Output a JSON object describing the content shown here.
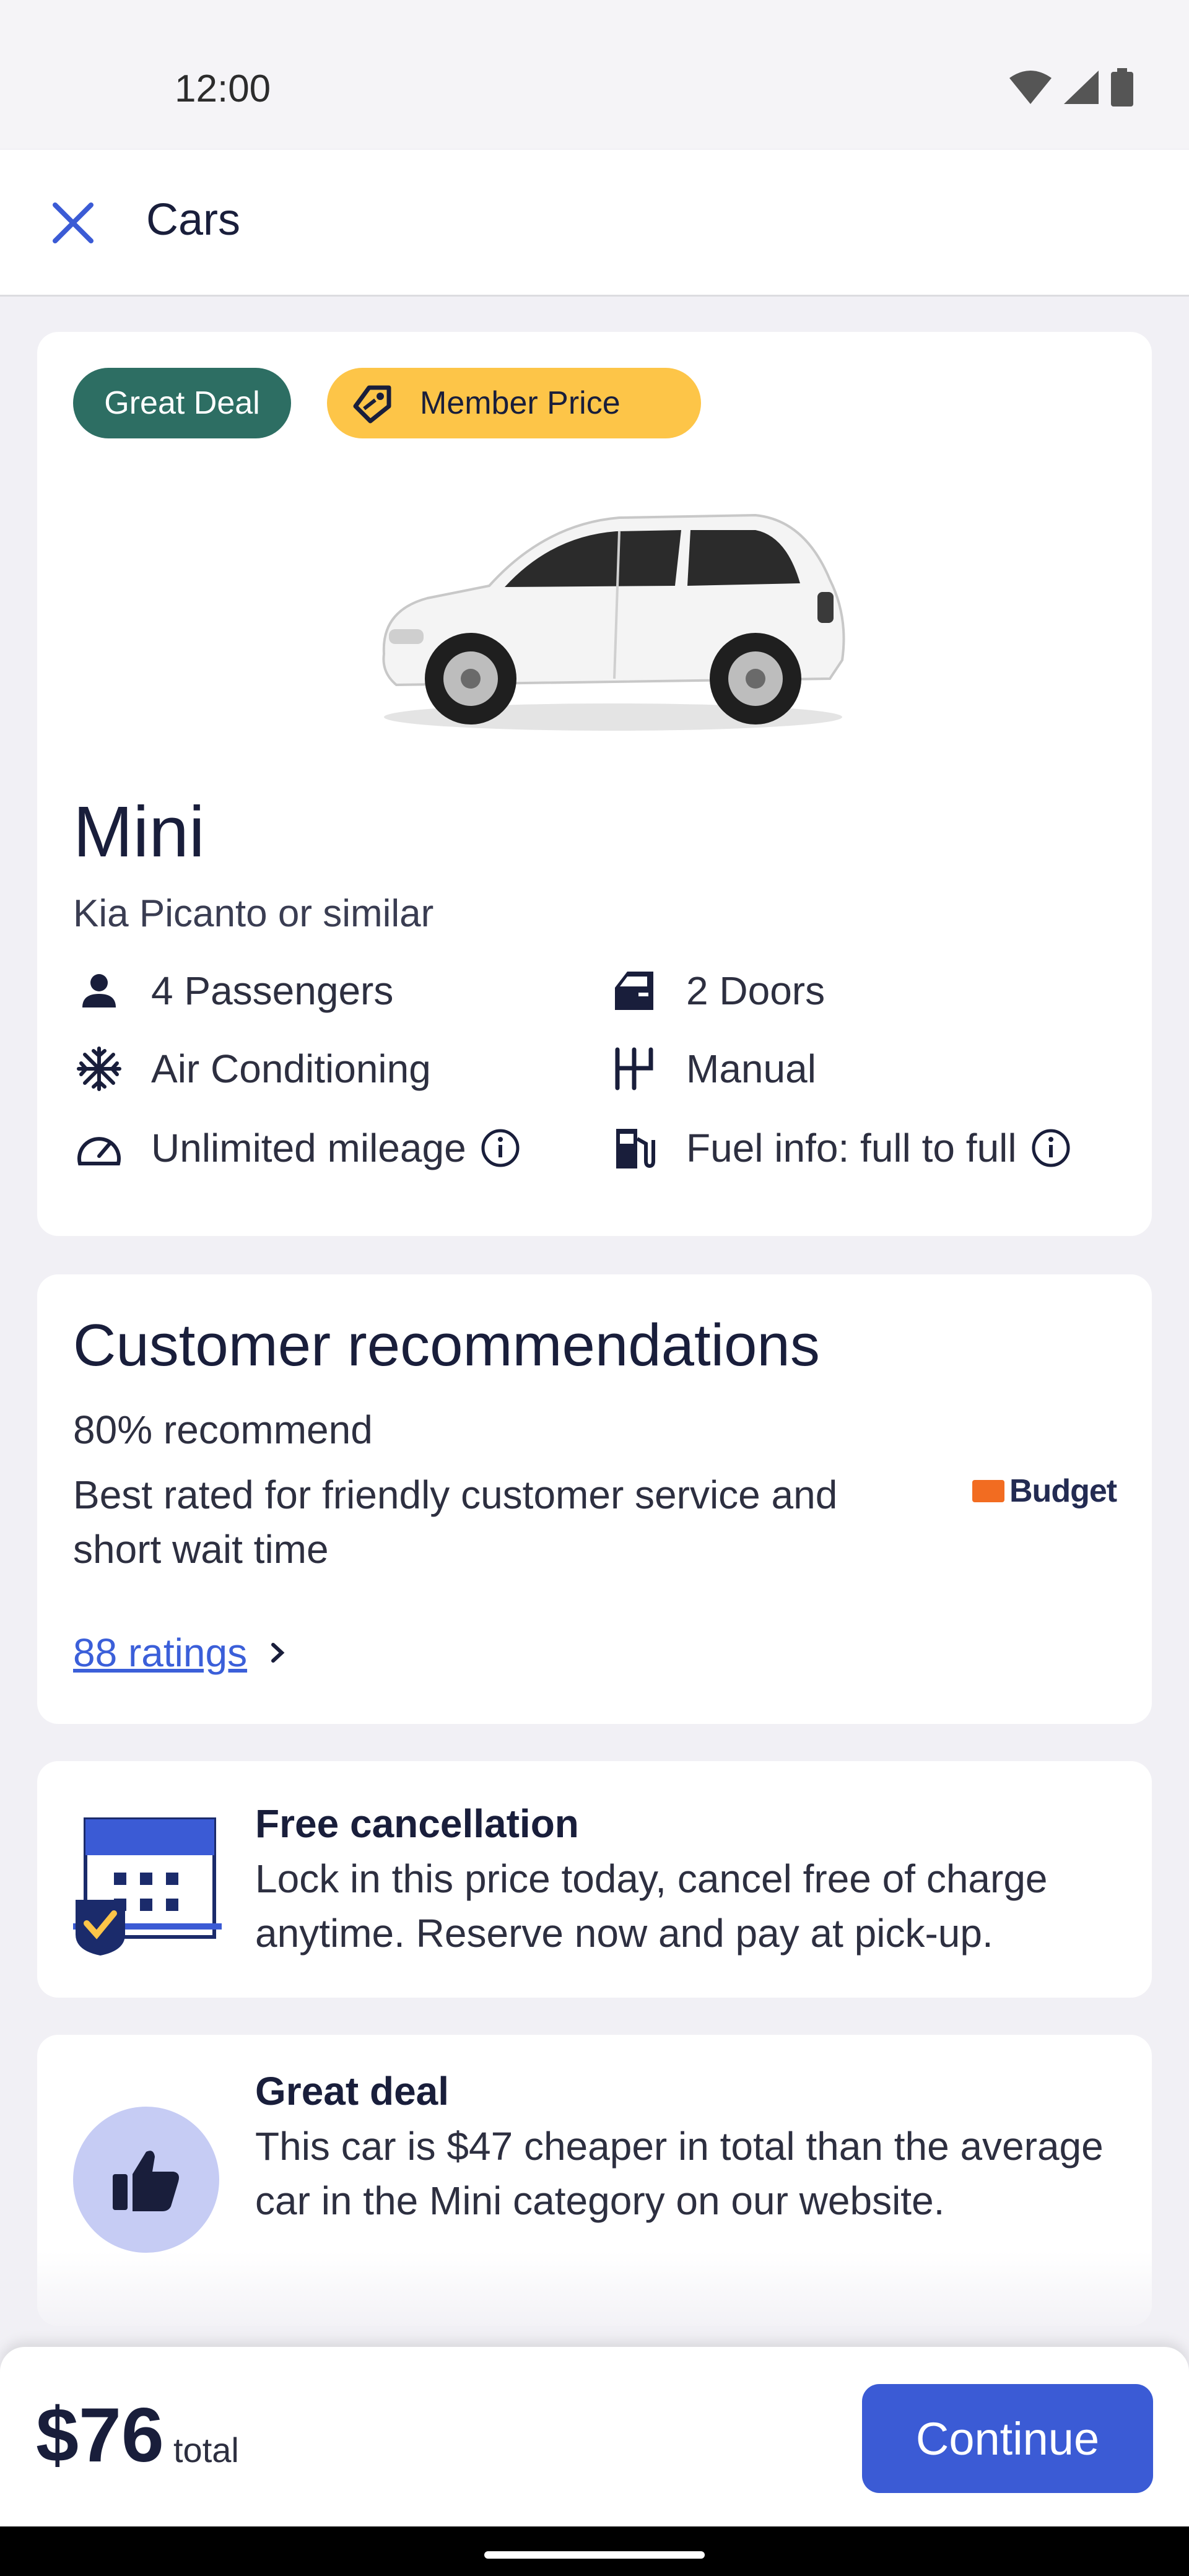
{
  "status_bar": {
    "time": "12:00",
    "icons": [
      "wifi-icon",
      "cell-signal-icon",
      "battery-icon"
    ]
  },
  "topbar": {
    "close_icon": "close-icon",
    "title": "Cars"
  },
  "car_card": {
    "badges": {
      "great_deal": "Great Deal",
      "member_price": "Member Price"
    },
    "title": "Mini",
    "subtitle": "Kia Picanto or similar",
    "features": [
      {
        "icon": "person-icon",
        "label": "4 Passengers"
      },
      {
        "icon": "car-door-icon",
        "label": "2 Doors"
      },
      {
        "icon": "snowflake-icon",
        "label": "Air Conditioning"
      },
      {
        "icon": "gearshift-icon",
        "label": "Manual"
      },
      {
        "icon": "speedometer-icon",
        "label": "Unlimited mileage",
        "info": true
      },
      {
        "icon": "fuel-pump-icon",
        "label": "Fuel info: full to full",
        "info": true
      }
    ]
  },
  "recommendations": {
    "title": "Customer recommendations",
    "percent_text": "80% recommend",
    "description": "Best rated for friendly customer service and short wait time",
    "logo_text": "Budget",
    "ratings_link": "88 ratings"
  },
  "free_cancellation": {
    "title": "Free cancellation",
    "text": "Lock in this price today, cancel free of charge anytime. Reserve now and pay at pick-up."
  },
  "great_deal": {
    "title": "Great deal",
    "text": "This car is $47 cheaper in total than the average car in the Mini category on our website."
  },
  "bottom_bar": {
    "price": "$76",
    "price_label": "total",
    "continue_label": "Continue"
  },
  "colors": {
    "accent": "#3b5bd5",
    "deal_green": "#2d6e63",
    "member_yellow": "#fdc548",
    "navy": "#191e3b"
  }
}
